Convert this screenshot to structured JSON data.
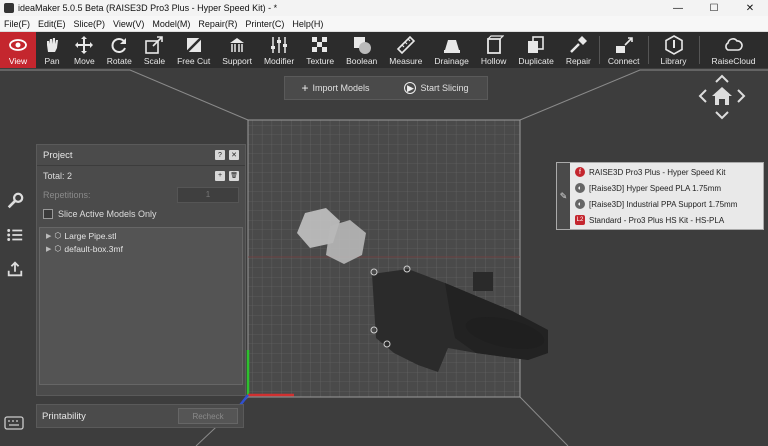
{
  "window": {
    "title": "ideaMaker 5.0.5 Beta (RAISE3D Pro3 Plus - Hyper Speed Kit) - *",
    "minimize": "—",
    "maximize": "☐",
    "close": "✕"
  },
  "menu": [
    "File(F)",
    "Edit(E)",
    "Slice(P)",
    "View(V)",
    "Model(M)",
    "Repair(R)",
    "Printer(C)",
    "Help(H)"
  ],
  "toolbar": [
    {
      "label": "View",
      "icon": "eye-icon"
    },
    {
      "label": "Pan",
      "icon": "hand-icon"
    },
    {
      "label": "Move",
      "icon": "move-arrows-icon"
    },
    {
      "label": "Rotate",
      "icon": "rotate-icon"
    },
    {
      "label": "Scale",
      "icon": "scale-icon"
    },
    {
      "label": "Free Cut",
      "icon": "free-cut-icon"
    },
    {
      "label": "Support",
      "icon": "support-icon"
    },
    {
      "label": "Modifier",
      "icon": "modifier-sliders-icon"
    },
    {
      "label": "Texture",
      "icon": "texture-icon"
    },
    {
      "label": "Boolean",
      "icon": "boolean-icon"
    },
    {
      "label": "Measure",
      "icon": "ruler-icon"
    },
    {
      "label": "Drainage",
      "icon": "drainage-icon"
    },
    {
      "label": "Hollow",
      "icon": "hollow-icon"
    },
    {
      "label": "Duplicate",
      "icon": "duplicate-icon"
    },
    {
      "label": "Repair",
      "icon": "wrench-hammer-icon"
    },
    {
      "label": "Connect",
      "icon": "connect-icon"
    },
    {
      "label": "Library",
      "icon": "library-icon"
    },
    {
      "label": "RaiseCloud",
      "icon": "cloud-icon"
    }
  ],
  "slice_bar": {
    "import": "Import Models",
    "start": "Start Slicing",
    "import_icon": "+",
    "start_icon": "▶"
  },
  "project_panel": {
    "title": "Project",
    "help_btn": "?",
    "close_btn": "✕",
    "total": "Total: 2",
    "add_btn": "+",
    "delete_btn": "🗑",
    "repetitions_label": "Repetitions:",
    "repetitions_value": "1",
    "slice_active": "Slice Active Models Only",
    "models": [
      "Large Pipe.stl",
      "default-box.3mf"
    ]
  },
  "printability": {
    "title": "Printability",
    "recheck": "Recheck"
  },
  "profile": {
    "items": [
      {
        "text": "RAISE3D Pro3 Plus - Hyper Speed Kit",
        "icon": "printer-icon",
        "color": "#c4262e",
        "badge": "f"
      },
      {
        "text": "[Raise3D] Hyper Speed PLA 1.75mm",
        "icon": "filament-icon",
        "color": "#666666",
        "badge": "◐"
      },
      {
        "text": "[Raise3D] Industrial PPA Support 1.75mm",
        "icon": "filament-icon",
        "color": "#666666",
        "badge": "◐"
      },
      {
        "text": "Standard - Pro3 Plus HS Kit - HS-PLA",
        "icon": "template-icon",
        "color": "#c4262e",
        "badge": "L2"
      }
    ]
  },
  "colors": {
    "accent": "#c4262e",
    "toolbar_bg": "#2c2c2c",
    "viewport_bg": "#3d3d3d"
  }
}
